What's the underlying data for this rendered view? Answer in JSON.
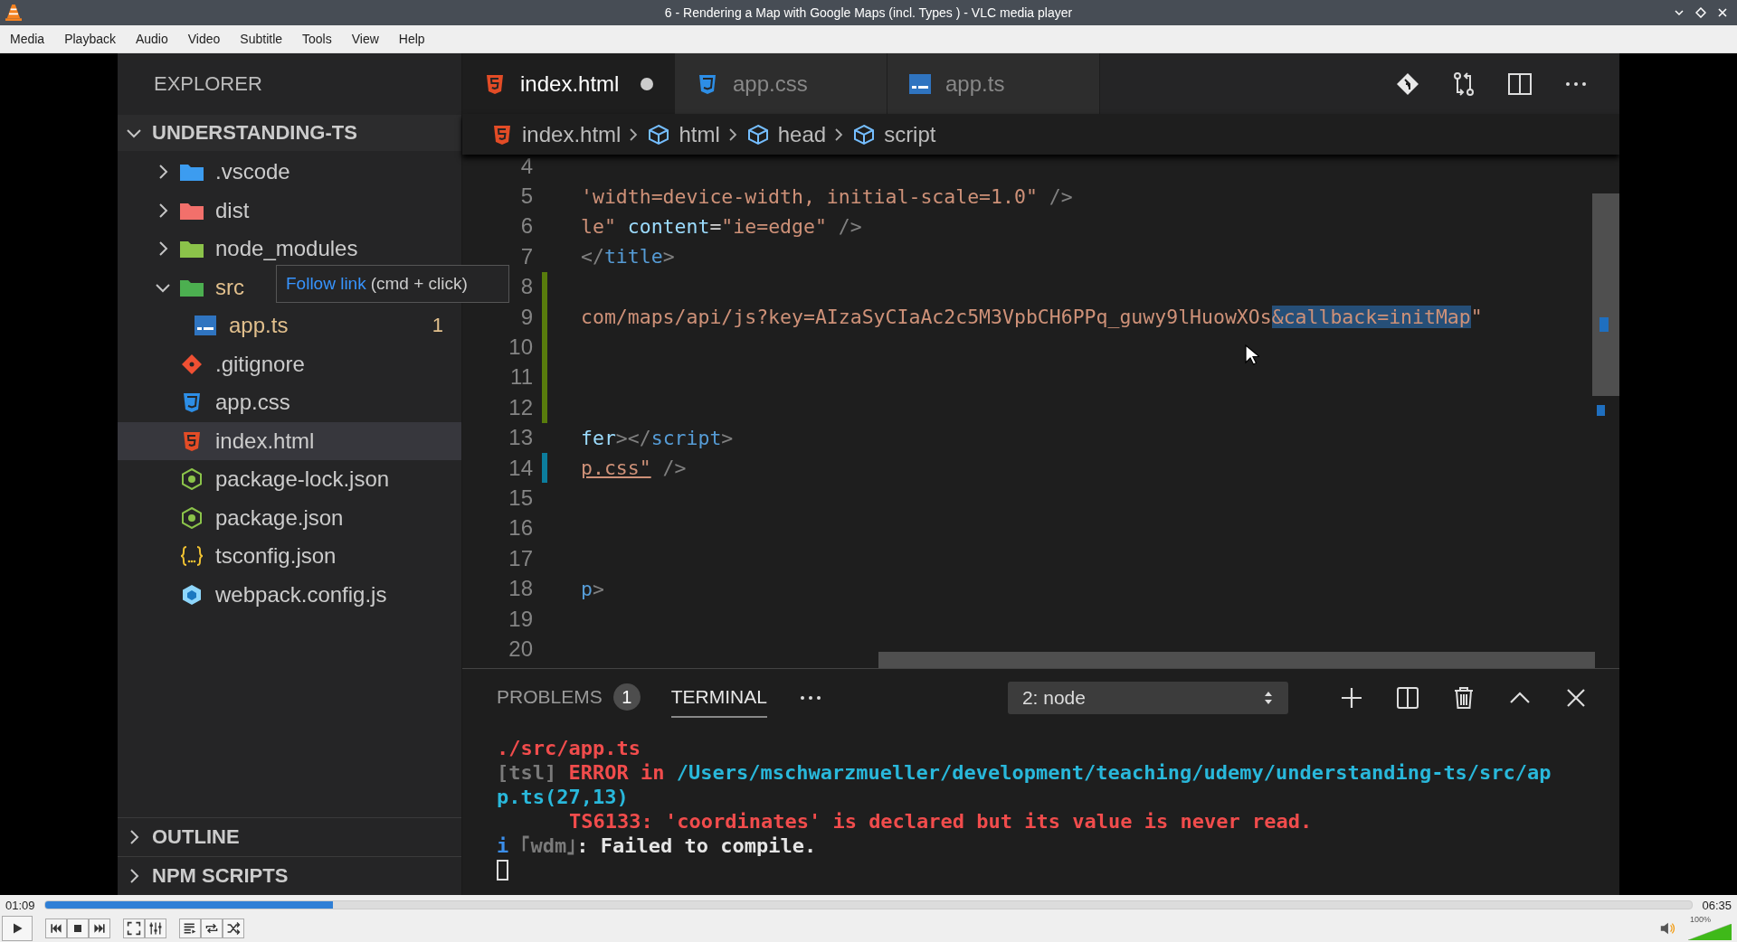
{
  "window": {
    "title": "6 - Rendering a Map with Google Maps (incl. Types ) - VLC media player"
  },
  "menu": [
    "Media",
    "Playback",
    "Audio",
    "Video",
    "Subtitle",
    "Tools",
    "View",
    "Help"
  ],
  "video": {
    "explorer": {
      "title": "EXPLORER",
      "project": {
        "label": "UNDERSTANDING-TS",
        "expanded": true
      },
      "tree": [
        {
          "name": ".vscode",
          "kind": "folder-vscode",
          "expanded": false,
          "warning": false,
          "selected": false
        },
        {
          "name": "dist",
          "kind": "folder-dist",
          "expanded": false,
          "warning": false,
          "selected": false
        },
        {
          "name": "node_modules",
          "kind": "folder-node",
          "expanded": false,
          "warning": false,
          "selected": false
        },
        {
          "name": "src",
          "kind": "folder-src",
          "expanded": true,
          "warning": true,
          "selected": false,
          "children": [
            {
              "name": "app.ts",
              "kind": "ts",
              "warning": true,
              "selected": false,
              "badge": "1"
            }
          ]
        },
        {
          "name": ".gitignore",
          "kind": "git",
          "warning": false,
          "selected": false
        },
        {
          "name": "app.css",
          "kind": "css",
          "warning": false,
          "selected": false
        },
        {
          "name": "index.html",
          "kind": "html",
          "warning": false,
          "selected": true
        },
        {
          "name": "package-lock.json",
          "kind": "node",
          "warning": false,
          "selected": false
        },
        {
          "name": "package.json",
          "kind": "node",
          "warning": false,
          "selected": false
        },
        {
          "name": "tsconfig.json",
          "kind": "json",
          "warning": false,
          "selected": false
        },
        {
          "name": "webpack.config.js",
          "kind": "webpack",
          "warning": false,
          "selected": false
        }
      ],
      "sections": [
        {
          "label": "OUTLINE",
          "expanded": false
        },
        {
          "label": "NPM SCRIPTS",
          "expanded": false
        }
      ]
    },
    "tooltip": {
      "link": "Follow link",
      "hint": "(cmd + click)"
    },
    "tabs": [
      {
        "label": "index.html",
        "kind": "html",
        "selected": true,
        "dirty": true
      },
      {
        "label": "app.css",
        "kind": "css",
        "selected": false,
        "dirty": false
      },
      {
        "label": "app.ts",
        "kind": "ts",
        "selected": false,
        "dirty": false
      }
    ],
    "breadcrumb": [
      {
        "label": "index.html",
        "kind": "html"
      },
      {
        "label": "html",
        "kind": "element"
      },
      {
        "label": "head",
        "kind": "element"
      },
      {
        "label": "script",
        "kind": "element"
      }
    ],
    "code": [
      {
        "number": "4",
        "added": false,
        "modified": false
      },
      {
        "number": "5",
        "added": false,
        "modified": false,
        "tokens": [
          {
            "text": "'width=device-width, initial-scale=1.0\"",
            "kind": "str"
          },
          {
            "text": " />",
            "kind": "punct"
          }
        ]
      },
      {
        "number": "6",
        "added": false,
        "modified": false,
        "tokens": [
          {
            "text": "le\"",
            "kind": "str"
          },
          {
            "text": " content",
            "kind": "attr"
          },
          {
            "text": "=",
            "kind": "eq"
          },
          {
            "text": "\"ie=edge\"",
            "kind": "str"
          },
          {
            "text": " />",
            "kind": "punct"
          }
        ]
      },
      {
        "number": "7",
        "added": false,
        "modified": false,
        "tokens": [
          {
            "text": "</",
            "kind": "punct"
          },
          {
            "text": "title",
            "kind": "tag"
          },
          {
            "text": ">",
            "kind": "punct"
          }
        ]
      },
      {
        "number": "8",
        "added": true,
        "modified": false
      },
      {
        "number": "9",
        "added": true,
        "modified": false,
        "tokens": [
          {
            "text": "com/maps/api/js?key=AIzaSyCIaAc2c5M3VpbCH6PPq_guwy9lHuowXOs",
            "kind": "str"
          },
          {
            "text": "&callback=initMap",
            "kind": "sel"
          },
          {
            "text": "\"",
            "kind": "str"
          }
        ]
      },
      {
        "number": "10",
        "added": true,
        "modified": false
      },
      {
        "number": "11",
        "added": true,
        "modified": false
      },
      {
        "number": "12",
        "added": true,
        "modified": false
      },
      {
        "number": "13",
        "added": false,
        "modified": false,
        "tokens": [
          {
            "text": "fer",
            "kind": "attr"
          },
          {
            "text": "></",
            "kind": "punct"
          },
          {
            "text": "script",
            "kind": "tag"
          },
          {
            "text": ">",
            "kind": "punct"
          }
        ]
      },
      {
        "number": "14",
        "added": false,
        "modified": true,
        "tokens": [
          {
            "text": "p.css\"",
            "kind": "link"
          },
          {
            "text": " />",
            "kind": "punct"
          }
        ]
      },
      {
        "number": "15",
        "added": false,
        "modified": false
      },
      {
        "number": "16",
        "added": false,
        "modified": false
      },
      {
        "number": "17",
        "added": false,
        "modified": false
      },
      {
        "number": "18",
        "added": false,
        "modified": false,
        "tokens": [
          {
            "text": "p",
            "kind": "tag"
          },
          {
            "text": ">",
            "kind": "punct"
          }
        ]
      },
      {
        "number": "19",
        "added": false,
        "modified": false
      },
      {
        "number": "20",
        "added": false,
        "modified": false
      }
    ],
    "panel": {
      "tabs": [
        {
          "label": "PROBLEMS",
          "badge": "1",
          "selected": false
        },
        {
          "label": "TERMINAL",
          "selected": true
        }
      ],
      "terminal_select": "2: node",
      "terminal": [
        {
          "indent": false,
          "segments": [
            {
              "text": "./src/app.ts",
              "kind": "err"
            }
          ]
        },
        {
          "indent": false,
          "segments": [
            {
              "text": "[tsl]",
              "kind": "dim"
            },
            {
              "text": " ERROR in ",
              "kind": "err"
            },
            {
              "text": "/Users/mschwarzmueller/development/teaching/udemy/understanding-ts/src/ap",
              "kind": "path"
            }
          ]
        },
        {
          "indent": false,
          "segments": [
            {
              "text": "p.ts(27,13)",
              "kind": "path"
            }
          ]
        },
        {
          "indent": true,
          "segments": [
            {
              "text": "TS6133: 'coordinates' is declared but its value is never read.",
              "kind": "err"
            }
          ]
        },
        {
          "indent": false,
          "segments": [
            {
              "text": "i",
              "kind": "info"
            },
            {
              "text": " ｢wdm｣",
              "kind": "dim"
            },
            {
              "text": ": Failed to compile.",
              "kind": "text"
            }
          ]
        }
      ]
    }
  },
  "player": {
    "elapsed": "01:09",
    "duration": "06:35",
    "level": 0.175,
    "volume": {
      "level": 1,
      "reading": "100%"
    }
  }
}
